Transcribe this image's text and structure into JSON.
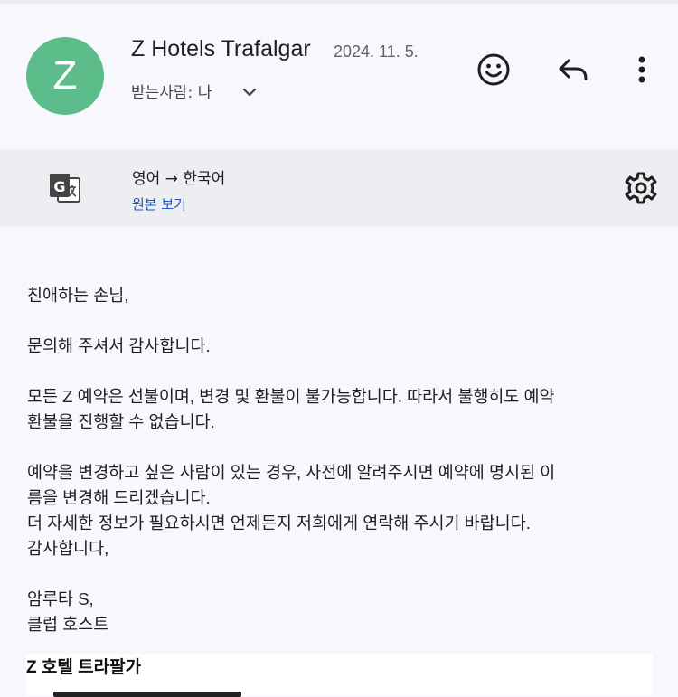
{
  "header": {
    "avatar_letter": "Z",
    "sender": "Z Hotels Trafalgar",
    "date": "2024. 11. 5.",
    "recipients": "받는사람: 나"
  },
  "translation": {
    "languages": "영어 → 한국어",
    "view_original": "원본 보기"
  },
  "body": {
    "greeting": "친애하는 손님,",
    "thanks_inquiry": "문의해 주셔서 감사합니다.",
    "policy_line1": "모든 Z 예약은 선불이며, 변경 및 환불이 불가능합니다. 따라서 불행히도 예약",
    "policy_line2": "환불을 진행할 수 없습니다.",
    "change_line1": "예약을 변경하고 싶은 사람이 있는 경우, 사전에 알려주시면 예약에 명시된 이",
    "change_line2": "름을 변경해 드리겠습니다.",
    "contact_line": "더 자세한 정보가 필요하시면 언제든지 저희에게 연락해 주시기 바랍니다.",
    "closing": "감사합니다,",
    "signer": "암루타 S,",
    "role": "클럽 호스트"
  },
  "signature": {
    "hotel_name": "Z 호텔 트라팔가"
  },
  "colors": {
    "avatar": "#5cbd8a",
    "link": "#1a55c4",
    "translate_bar": "#eceef1"
  }
}
